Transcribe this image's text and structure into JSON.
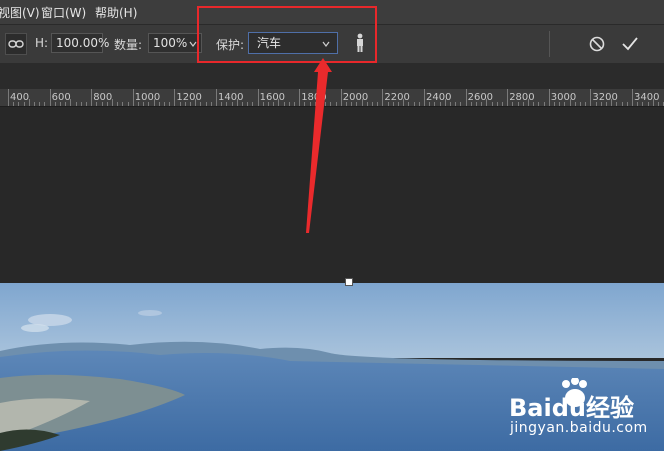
{
  "menu": {
    "items": [
      "视图(V)",
      "窗口(W)",
      "帮助(H)"
    ]
  },
  "options": {
    "h_label": "H:",
    "h_value": "100.00%",
    "amount_label": "数量:",
    "amount_value": "100%",
    "protect_label": "保护:",
    "protect_value": "汽车"
  },
  "icons": {
    "link": "link-icon",
    "dropdown_caret": "chevron-down-icon",
    "person": "person-icon",
    "cancel": "cancel-icon",
    "confirm": "checkmark-icon"
  },
  "ruler": {
    "labels": [
      "400",
      "600",
      "800",
      "1000",
      "1200",
      "1400",
      "1600",
      "1800",
      "2000",
      "2200",
      "2400",
      "2600",
      "2800",
      "3000",
      "3200",
      "3400"
    ]
  },
  "colors": {
    "highlight": "#e8282b",
    "accent": "#4f6fa8"
  },
  "watermark": {
    "brand": "Baidu经验",
    "domain": "jingyan.baidu.com"
  }
}
